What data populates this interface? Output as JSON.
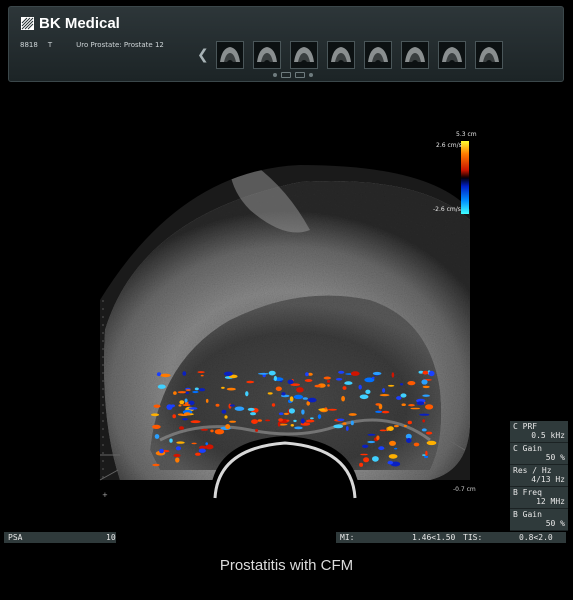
{
  "brand": {
    "name": "BK Medical",
    "logo_icon": "bk-logo-icon"
  },
  "patient": {
    "id": "8818",
    "marker": "T",
    "exam": "Uro Prostate: Prostate 12"
  },
  "thumbnails": {
    "count": 8,
    "nav_icon": "chevron-left-icon"
  },
  "colorbar": {
    "top_label": "5.3 cm",
    "max_velocity": "2.6 cm/s",
    "min_velocity": "-2.6 cm/s"
  },
  "depth_label": "-0.7 cm",
  "params": [
    {
      "label": "C PRF",
      "value": "0.5 kHz"
    },
    {
      "label": "C Gain",
      "value": "50 %"
    },
    {
      "label": "Res / Hz",
      "value": "4/13 Hz"
    },
    {
      "label": "B Freq",
      "value": "12 MHz"
    },
    {
      "label": "B Gain",
      "value": "50 %"
    }
  ],
  "psa": {
    "label": "PSA",
    "value": "10"
  },
  "mi": {
    "mi_label": "MI:",
    "mi_value": "1.46<1.50",
    "tis_label": "TIS:",
    "tis_value": "0.8<2.0"
  },
  "caption": "Prostatitis with CFM",
  "colors": {
    "panel": "#2f3a3b",
    "header": "#243032",
    "doppler_red": "#ff5a00",
    "doppler_blue": "#1a5cff"
  }
}
